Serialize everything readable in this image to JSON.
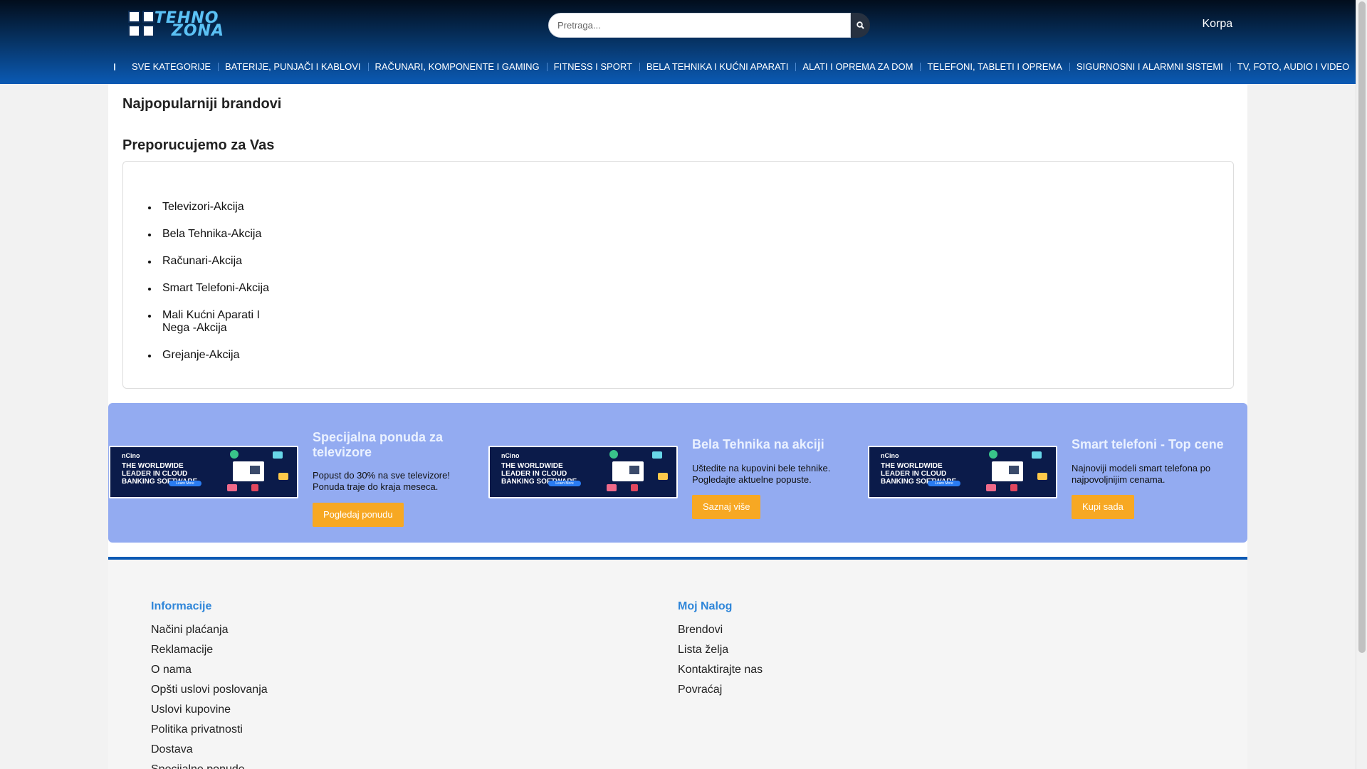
{
  "header": {
    "logo_text_top": "TEHNO",
    "logo_text_bottom": "ZONA",
    "search_placeholder": "Pretraga...",
    "search_icon": "search-icon",
    "cart_icon": "cart-icon",
    "cart_label": "Korpa"
  },
  "nav": {
    "menu_icon": "menu-icon",
    "items": [
      "SVE KATEGORIJE",
      "BATERIJE, PUNJAČI I KABLOVI",
      "RAČUNARI, KOMPONENTE I GAMING",
      "FITNESS I SPORT",
      "BELA TEHNIKA I KUĆNI APARATI",
      "ALATI I OPREMA ZA DOM",
      "TELEFONI, TABLETI I OPREMA",
      "SIGURNOSNI I ALARMNI SISTEMI",
      "TV, FOTO, AUDIO I VIDEO"
    ]
  },
  "main": {
    "brands_heading": "Najpopularniji brandovi",
    "recommend_heading": "Preporucujemo za Vas",
    "recommend_items": [
      "Televizori-Akcija",
      "Bela Tehnika-Akcija",
      "Računari-Akcija",
      "Smart Telefoni-Akcija",
      "Mali Kućni Aparati I Nega -Akcija",
      "Grejanje-Akcija"
    ]
  },
  "ad": {
    "brand": "nCino",
    "headline": "THE WORLDWIDE LEADER IN CLOUD BANKING SOFTWARE",
    "cta": "Learn More"
  },
  "promos": [
    {
      "title": "Specijalna ponuda za televizore",
      "desc": "Popust do 30% na sve televizore! Ponuda traje do kraja meseca.",
      "button": "Pogledaj ponudu"
    },
    {
      "title": "Bela Tehnika na akciji",
      "desc": "Uštedite na kupovini bele tehnike. Pogledajte aktuelne popuste.",
      "button": "Saznaj više"
    },
    {
      "title": "Smart telefoni - Top cene",
      "desc": "Najnoviji modeli smart telefona po najpovoljnijim cenama.",
      "button": "Kupi sada"
    }
  ],
  "footer": {
    "info_heading": "Informacije",
    "info_links": [
      "Načini plaćanja",
      "Reklamacije",
      "O nama",
      "Opšti uslovi poslovanja",
      "Uslovi kupovine",
      "Politika privatnosti",
      "Dostava",
      "Specijalne ponude"
    ],
    "account_heading": "Moj Nalog",
    "account_links": [
      "Brendovi",
      "Lista želja",
      "Kontaktirajte nas",
      "Povraćaj"
    ]
  },
  "colors": {
    "header_dark": "#020d1c",
    "header_blue": "#0b5ab4",
    "promo_bg": "#93abf1",
    "button_orange": "#f7a823",
    "footer_heading": "#2f86d9"
  }
}
